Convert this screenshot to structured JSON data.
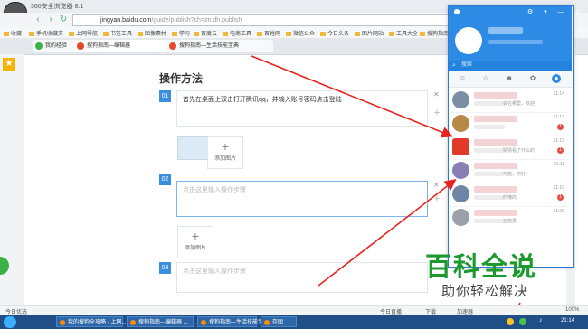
{
  "browser": {
    "title": "360安全浏览器 8.1",
    "url_host": "jingyan.baidu.com",
    "url_path": "/guide/publish?ch=zn.dh.publish"
  },
  "bookmarks": [
    "收藏",
    "手机收藏夹",
    "上网导航",
    "书签工具",
    "图像素材",
    "学习",
    "百度云",
    "电商工具",
    "百姓网",
    "微信公众",
    "今日头条",
    "图片网站",
    "工具大全",
    "搜狗指南"
  ],
  "tabs": [
    {
      "label": "我的经验",
      "color": "#3bb14a"
    },
    {
      "label": "搜狗指南—编辑器",
      "color": "#e8452c"
    },
    {
      "label": "搜狗指南—生活技能宝典",
      "color": "#e8452c"
    }
  ],
  "editor": {
    "section_title": "操作方法",
    "steps": [
      {
        "num": "01",
        "text": "首先在桌面上双击打开腾讯qq，并输入账号密码点击登陆"
      },
      {
        "num": "02",
        "text": "点击这里输入操作步骤"
      },
      {
        "num": "03",
        "text": "点击这里输入操作步骤"
      }
    ],
    "add_image_label": "添加图片"
  },
  "qq": {
    "search_label": "搜索",
    "contacts": [
      {
        "time": "21:14",
        "msg": "会在哪里，欢迎",
        "badge": "",
        "color": "#7a8fa3"
      },
      {
        "time": "21:13",
        "msg": "",
        "badge": "1",
        "color": "#b88848"
      },
      {
        "time": "21:13",
        "msg": "猜猜看了什么的",
        "badge": "1",
        "color": "#e23a2a"
      },
      {
        "time": "21:11",
        "msg": "可能，你好",
        "badge": "",
        "color": "#8a7fb5"
      },
      {
        "time": "21:10",
        "msg": "你懂的",
        "badge": "1",
        "color": "#6f85a6"
      },
      {
        "time": "21:09",
        "msg": "正能量",
        "badge": "",
        "color": "#9aa0a8"
      }
    ]
  },
  "watermark": {
    "title": "百科全说",
    "subtitle": "助你轻松解决"
  },
  "statusbar": {
    "left": "今日优选",
    "right": [
      "今日直播",
      "下载",
      "加速器",
      "100%"
    ]
  },
  "taskbar": {
    "items": [
      "我的搜狗全攻略 - 上网...",
      "搜狗指南—编辑器 ...",
      "搜狗指南—生活技能宝...",
      "存图"
    ],
    "clock": "21:14"
  }
}
